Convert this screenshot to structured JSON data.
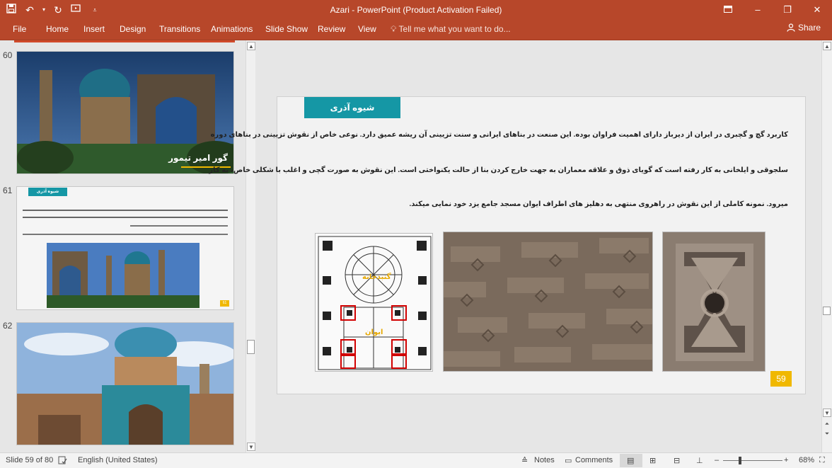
{
  "app": {
    "title": "Azari - PowerPoint (Product Activation Failed)"
  },
  "ribbon": {
    "tabs": [
      "File",
      "Home",
      "Insert",
      "Design",
      "Transitions",
      "Animations",
      "Slide Show",
      "Review",
      "View"
    ],
    "tell_me": "Tell me what you want to do...",
    "share": "Share"
  },
  "thumbnails": [
    {
      "number": "60",
      "caption": "گور امیر تیمور"
    },
    {
      "number": "61",
      "title": "شیوه آذری",
      "badge": "61"
    },
    {
      "number": "62"
    }
  ],
  "slide": {
    "title": "شیوه آذری",
    "lines": [
      "کاربرد گچ و گچبری در ایران از دیرباز دارای اهمیت فراوان بوده. این صنعت در بناهای ایرانی و سنت تزیینی آن ریشه عمیق دارد. نوعی خاص از نقوش تزیینی در بناهای دوره",
      "سلجوقی و ایلخانی به کار رفته است که گویای ذوق و علاقه معماران به جهت خارج کردن بنا از حالت یکنواختی است. این نقوش به صورت گچی و اغلب با شکلی خاص، به کار",
      "میرود. نمونه کاملی از این نقوش در راهروی منتهی به دهلیز های اطراف ایوان مسجد جامع یزد خود نمایی میکند."
    ],
    "plan_labels": {
      "dome": "گنبدخانه",
      "iwan": "ایوان"
    },
    "number": "59"
  },
  "status": {
    "slide_info": "Slide 59 of 80",
    "language": "English (United States)",
    "notes": "Notes",
    "comments": "Comments",
    "zoom": "68%"
  }
}
